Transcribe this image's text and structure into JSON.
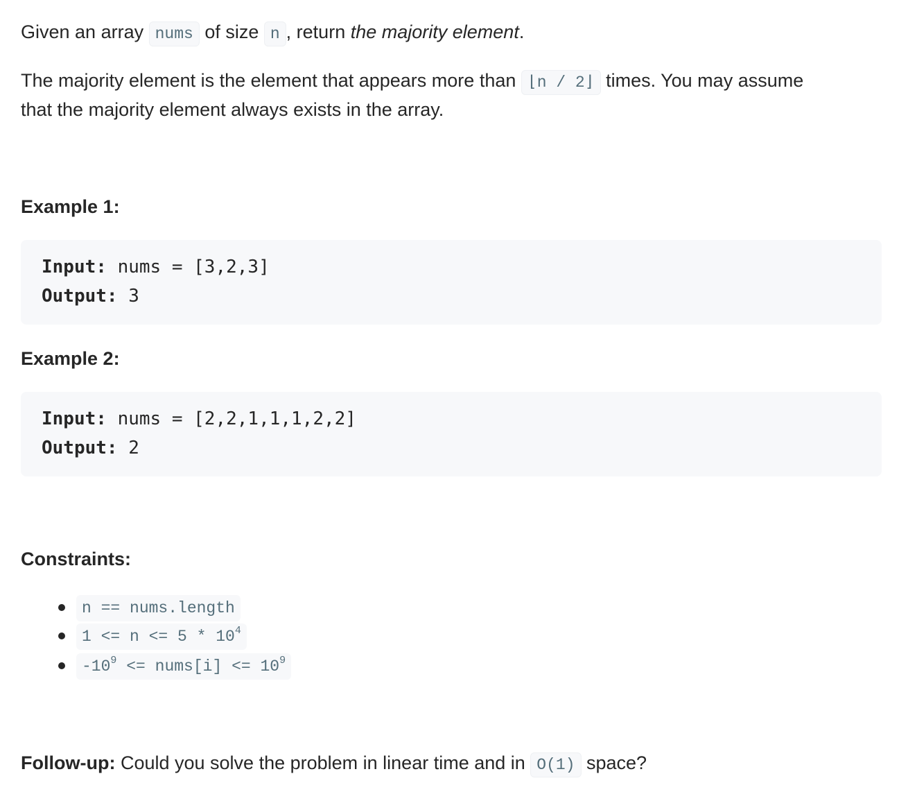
{
  "intro": {
    "p1_a": "Given an array ",
    "p1_code_nums": "nums",
    "p1_b": " of size ",
    "p1_code_n": "n",
    "p1_c": ", return ",
    "p1_em": "the majority element",
    "p1_d": ".",
    "p2_a": "The majority element is the element that appears more than ",
    "p2_code": "⌊n / 2⌋",
    "p2_b": " times. You may assume",
    "p2_line2": "that the majority element always exists in the array."
  },
  "examples": [
    {
      "heading": "Example 1:",
      "input_label": "Input:",
      "input_value": " nums = [3,2,3]",
      "output_label": "Output:",
      "output_value": " 3"
    },
    {
      "heading": "Example 2:",
      "input_label": "Input:",
      "input_value": " nums = [2,2,1,1,1,2,2]",
      "output_label": "Output:",
      "output_value": " 2"
    }
  ],
  "constraints": {
    "heading": "Constraints:",
    "items": [
      {
        "text": "n == nums.length"
      },
      {
        "base": "1 <= n <= 5 * 10",
        "exp": "4"
      },
      {
        "pre": "-10",
        "pre_exp": "9",
        "mid": " <= nums[i] <= 10",
        "post_exp": "9"
      }
    ]
  },
  "followup": {
    "label": "Follow-up:",
    "text_a": " Could you solve the problem in linear time and in ",
    "code": "O(1)",
    "text_b": " space?"
  }
}
